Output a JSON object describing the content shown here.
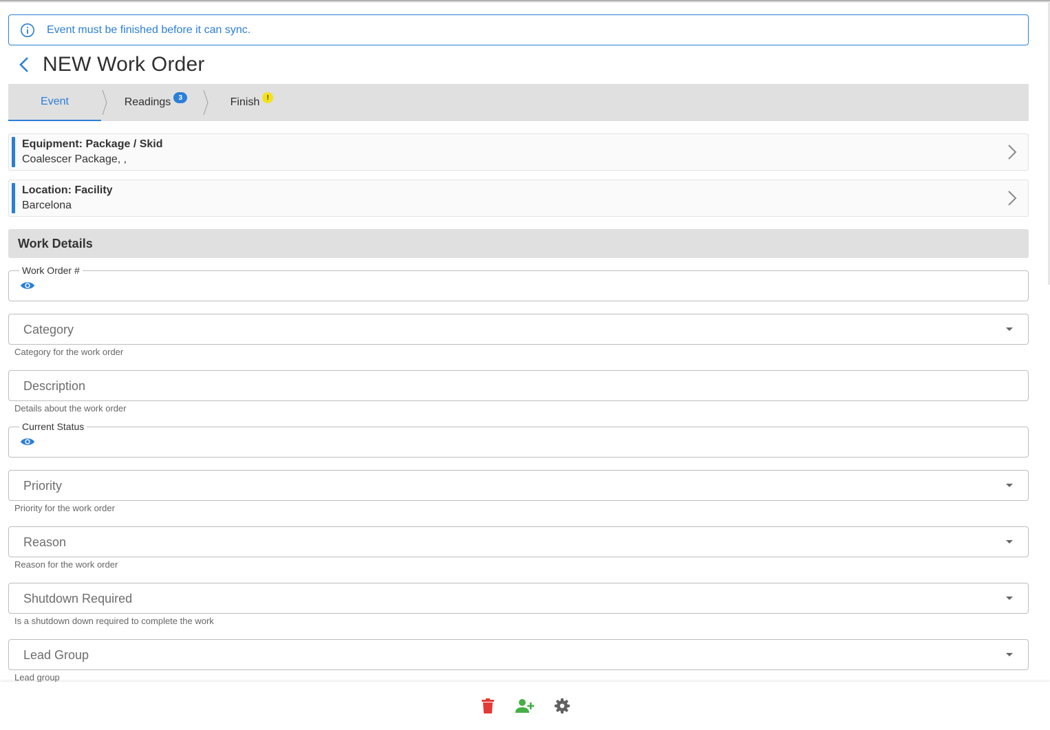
{
  "banner": {
    "message": "Event must be finished before it can sync.",
    "icon": "info-icon",
    "color": "#2b7fd7"
  },
  "header": {
    "title": "NEW Work Order",
    "back_icon": "chevron-left-icon"
  },
  "tabs": [
    {
      "label": "Event",
      "active": true
    },
    {
      "label": "Readings",
      "badge": "3"
    },
    {
      "label": "Finish",
      "badge": "!"
    }
  ],
  "cards": [
    {
      "title": "Equipment: Package / Skid",
      "value": "Coalescer Package, ,"
    },
    {
      "title": "Location: Facility",
      "value": "Barcelona"
    }
  ],
  "section": {
    "title": "Work Details"
  },
  "fields": {
    "work_order": {
      "label": "Work Order #"
    },
    "category": {
      "placeholder": "Category",
      "hint": "Category for the work order"
    },
    "description": {
      "placeholder": "Description",
      "hint": "Details about the work order"
    },
    "current_status": {
      "label": "Current Status"
    },
    "priority": {
      "placeholder": "Priority",
      "hint": "Priority for the work order"
    },
    "reason": {
      "placeholder": "Reason",
      "hint": "Reason for the work order"
    },
    "shutdown": {
      "placeholder": "Shutdown Required",
      "hint": "Is a shutdown down required to complete the work"
    },
    "lead_group": {
      "placeholder": "Lead Group",
      "hint": "Lead group"
    }
  },
  "actions": [
    {
      "name": "delete",
      "icon": "trash-icon",
      "color": "#e53935"
    },
    {
      "name": "add-user",
      "icon": "person-add-icon",
      "color": "#43b047"
    },
    {
      "name": "settings",
      "icon": "gear-icon",
      "color": "#616161"
    }
  ]
}
